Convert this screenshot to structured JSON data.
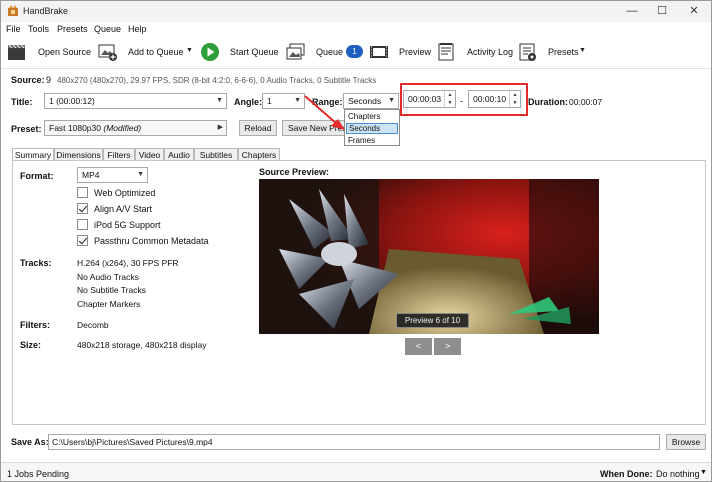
{
  "window": {
    "title": "HandBrake",
    "minimize": "—",
    "maximize": "☐",
    "close": "✕"
  },
  "menu": [
    "File",
    "Tools",
    "Presets",
    "Queue",
    "Help"
  ],
  "toolbar": {
    "open_source": "Open Source",
    "add_to_queue": "Add to Queue",
    "start_queue": "Start Queue",
    "queue": "Queue",
    "queue_count": "1",
    "preview": "Preview",
    "activity_log": "Activity Log",
    "presets": "Presets",
    "caret": "▼"
  },
  "source": {
    "label": "Source:",
    "number": "9",
    "info": "480x270 (480x270), 29.97 FPS, SDR (8-bit 4:2:0, 6-6-6), 0 Audio Tracks, 0 Subtitle Tracks"
  },
  "title_row": {
    "title_label": "Title:",
    "title_value": "1 (00:00:12)",
    "angle_label": "Angle:",
    "angle_value": "1",
    "range_label": "Range:",
    "range_value": "Seconds",
    "start": "00:00:03",
    "dash": "-",
    "end": "00:00:10",
    "duration_label": "Duration:",
    "duration_value": "00:00:07"
  },
  "range_options": [
    "Chapters",
    "Seconds",
    "Frames"
  ],
  "preset": {
    "label": "Preset:",
    "name": "Fast 1080p30",
    "modified": "(Modified)",
    "reload": "Reload",
    "save_new": "Save New Preset"
  },
  "tabs": [
    "Summary",
    "Dimensions",
    "Filters",
    "Video",
    "Audio",
    "Subtitles",
    "Chapters"
  ],
  "summary": {
    "format_label": "Format:",
    "format_value": "MP4",
    "checkboxes": [
      {
        "label": "Web Optimized",
        "checked": false
      },
      {
        "label": "Align A/V Start",
        "checked": true
      },
      {
        "label": "iPod 5G Support",
        "checked": false
      },
      {
        "label": "Passthru Common Metadata",
        "checked": true
      }
    ],
    "tracks_label": "Tracks:",
    "tracks": [
      "H.264 (x264), 30 FPS PFR",
      "No Audio Tracks",
      "No Subtitle Tracks",
      "Chapter Markers"
    ],
    "filters_label": "Filters:",
    "filters_value": "Decomb",
    "size_label": "Size:",
    "size_value": "480x218 storage, 480x218 display"
  },
  "preview": {
    "label": "Source Preview:",
    "caption": "Preview 6 of 10",
    "prev": "<",
    "next": ">"
  },
  "save_as": {
    "label": "Save As:",
    "path": "C:\\Users\\bj\\Pictures\\Saved Pictures\\9.mp4",
    "browse": "Browse"
  },
  "status": {
    "jobs": "1 Jobs Pending",
    "when_done_label": "When Done:",
    "when_done_value": "Do nothing"
  },
  "colors": {
    "accent": "#1f5fbf",
    "highlight": "#e32b2b",
    "play_green": "#2e9e3a"
  }
}
